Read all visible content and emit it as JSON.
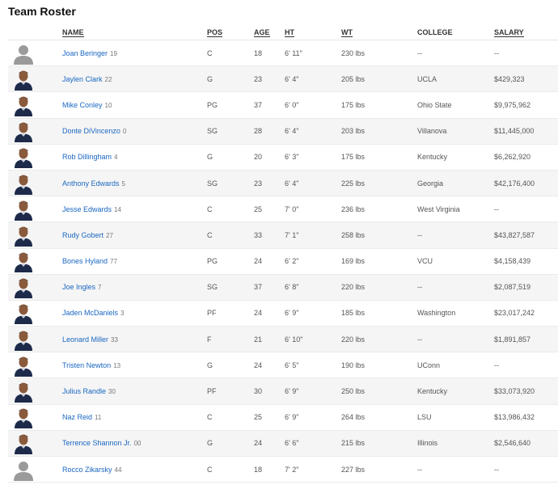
{
  "title": "Team Roster",
  "columns": {
    "name": "NAME",
    "pos": "POS",
    "age": "AGE",
    "ht": "HT",
    "wt": "WT",
    "college": "COLLEGE",
    "salary": "SALARY"
  },
  "players": [
    {
      "name": "Joan Beringer",
      "jersey": "19",
      "pos": "C",
      "age": "18",
      "ht": "6' 11\"",
      "wt": "230 lbs",
      "college": "--",
      "salary": "--",
      "photo": "silhouette"
    },
    {
      "name": "Jaylen Clark",
      "jersey": "22",
      "pos": "G",
      "age": "23",
      "ht": "6' 4\"",
      "wt": "205 lbs",
      "college": "UCLA",
      "salary": "$429,323",
      "photo": "headshot"
    },
    {
      "name": "Mike Conley",
      "jersey": "10",
      "pos": "PG",
      "age": "37",
      "ht": "6' 0\"",
      "wt": "175 lbs",
      "college": "Ohio State",
      "salary": "$9,975,962",
      "photo": "headshot"
    },
    {
      "name": "Donte DiVincenzo",
      "jersey": "0",
      "pos": "SG",
      "age": "28",
      "ht": "6' 4\"",
      "wt": "203 lbs",
      "college": "Villanova",
      "salary": "$11,445,000",
      "photo": "headshot"
    },
    {
      "name": "Rob Dillingham",
      "jersey": "4",
      "pos": "G",
      "age": "20",
      "ht": "6' 3\"",
      "wt": "175 lbs",
      "college": "Kentucky",
      "salary": "$6,262,920",
      "photo": "headshot"
    },
    {
      "name": "Anthony Edwards",
      "jersey": "5",
      "pos": "SG",
      "age": "23",
      "ht": "6' 4\"",
      "wt": "225 lbs",
      "college": "Georgia",
      "salary": "$42,176,400",
      "photo": "headshot"
    },
    {
      "name": "Jesse Edwards",
      "jersey": "14",
      "pos": "C",
      "age": "25",
      "ht": "7' 0\"",
      "wt": "236 lbs",
      "college": "West Virginia",
      "salary": "--",
      "photo": "headshot"
    },
    {
      "name": "Rudy Gobert",
      "jersey": "27",
      "pos": "C",
      "age": "33",
      "ht": "7' 1\"",
      "wt": "258 lbs",
      "college": "--",
      "salary": "$43,827,587",
      "photo": "headshot"
    },
    {
      "name": "Bones Hyland",
      "jersey": "77",
      "pos": "PG",
      "age": "24",
      "ht": "6' 2\"",
      "wt": "169 lbs",
      "college": "VCU",
      "salary": "$4,158,439",
      "photo": "headshot"
    },
    {
      "name": "Joe Ingles",
      "jersey": "7",
      "pos": "SG",
      "age": "37",
      "ht": "6' 8\"",
      "wt": "220 lbs",
      "college": "--",
      "salary": "$2,087,519",
      "photo": "headshot"
    },
    {
      "name": "Jaden McDaniels",
      "jersey": "3",
      "pos": "PF",
      "age": "24",
      "ht": "6' 9\"",
      "wt": "185 lbs",
      "college": "Washington",
      "salary": "$23,017,242",
      "photo": "headshot"
    },
    {
      "name": "Leonard Miller",
      "jersey": "33",
      "pos": "F",
      "age": "21",
      "ht": "6' 10\"",
      "wt": "220 lbs",
      "college": "--",
      "salary": "$1,891,857",
      "photo": "headshot"
    },
    {
      "name": "Tristen Newton",
      "jersey": "13",
      "pos": "G",
      "age": "24",
      "ht": "6' 5\"",
      "wt": "190 lbs",
      "college": "UConn",
      "salary": "--",
      "photo": "headshot"
    },
    {
      "name": "Julius Randle",
      "jersey": "30",
      "pos": "PF",
      "age": "30",
      "ht": "6' 9\"",
      "wt": "250 lbs",
      "college": "Kentucky",
      "salary": "$33,073,920",
      "photo": "headshot"
    },
    {
      "name": "Naz Reid",
      "jersey": "11",
      "pos": "C",
      "age": "25",
      "ht": "6' 9\"",
      "wt": "264 lbs",
      "college": "LSU",
      "salary": "$13,986,432",
      "photo": "headshot"
    },
    {
      "name": "Terrence Shannon Jr.",
      "jersey": "00",
      "pos": "G",
      "age": "24",
      "ht": "6' 6\"",
      "wt": "215 lbs",
      "college": "Illinois",
      "salary": "$2,546,640",
      "photo": "headshot"
    },
    {
      "name": "Rocco Zikarsky",
      "jersey": "44",
      "pos": "C",
      "age": "18",
      "ht": "7' 2\"",
      "wt": "227 lbs",
      "college": "--",
      "salary": "--",
      "photo": "silhouette"
    }
  ]
}
